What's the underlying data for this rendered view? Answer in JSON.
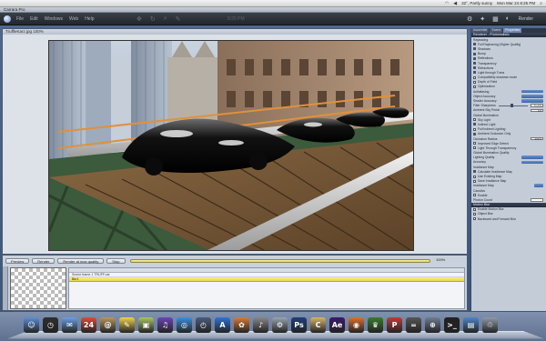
{
  "menubar": {
    "weather": "32°, Partly sunny",
    "clock": "Mon Mar 24  8:25 PM"
  },
  "app": {
    "title": "Carrara Pro",
    "menus": [
      "File",
      "Edit",
      "Windows",
      "Web",
      "Help"
    ],
    "toolbar_clock": "8:25 PM",
    "render_label": "Render"
  },
  "document": {
    "title": "TruffleKarz.jpg 100%"
  },
  "render_bar": {
    "buttons": [
      "Preview",
      "Render",
      "Render at max quality",
      "Stop"
    ],
    "progress": 1.0,
    "progress_label": "100%",
    "list_row_1": "Scene frame 1 TRUFF.car",
    "list_row_2": "Bkr1"
  },
  "panel": {
    "tabs": [
      "Assemble",
      "Scene",
      "Properties"
    ],
    "section_title": "Renderer - Photorealistic",
    "rows": [
      {
        "label": "Raytracing",
        "kind": "text"
      },
      {
        "label": "Full Raytracing (Higher Quality)",
        "kind": "check",
        "on": true
      },
      {
        "label": "Shadows",
        "kind": "check",
        "on": true
      },
      {
        "label": "Bump",
        "kind": "check",
        "on": true
      },
      {
        "label": "Reflections",
        "kind": "check",
        "on": true
      },
      {
        "label": "Transparency",
        "kind": "check",
        "on": true
      },
      {
        "label": "Refractions",
        "kind": "check",
        "on": true
      },
      {
        "label": "Light through Trans",
        "kind": "check",
        "on": true
      },
      {
        "label": "Compatibility shadows mode",
        "kind": "check",
        "on": false
      },
      {
        "label": "Depth of Field",
        "kind": "check",
        "on": false
      },
      {
        "label": "Optimization",
        "kind": "check",
        "on": false
      },
      {
        "label": "Antialiasing",
        "kind": "popup"
      },
      {
        "label": "Object Accuracy",
        "kind": "popup"
      },
      {
        "label": "Shader Accuracy",
        "kind": "popup"
      },
      {
        "label": "Filter Sharpness",
        "kind": "slider",
        "value": "71.0%"
      },
      {
        "label": "Ambient Sky Portal",
        "kind": "field",
        "value": "0.0"
      },
      {
        "label": "Global Illumination",
        "kind": "text"
      },
      {
        "label": "Sky Light",
        "kind": "check",
        "on": false
      },
      {
        "label": "Indirect Light",
        "kind": "check",
        "on": true
      },
      {
        "label": "Full Indirect Lighting",
        "kind": "check",
        "on": false
      },
      {
        "label": "Ambient Occlusion Only",
        "kind": "check",
        "on": true
      },
      {
        "label": "Occlusion Radius",
        "kind": "field",
        "value": "100.0"
      },
      {
        "label": "Improved Edge Detect",
        "kind": "check",
        "on": false
      },
      {
        "label": "Light Through Transparency",
        "kind": "check",
        "on": false
      },
      {
        "label": "Global Illumination Quality",
        "kind": "text"
      },
      {
        "label": "Lighting Quality",
        "kind": "popup"
      },
      {
        "label": "Accuracy",
        "kind": "popup"
      },
      {
        "label": "Irradiance Map",
        "kind": "text"
      },
      {
        "label": "Calculate Irradiance Map",
        "kind": "check",
        "on": true
      },
      {
        "label": "Use Existing Map",
        "kind": "check",
        "on": false
      },
      {
        "label": "Save Irradiance Map",
        "kind": "check",
        "on": false
      },
      {
        "label": "Irradiance Map",
        "kind": "button"
      },
      {
        "label": "Caustics",
        "kind": "text"
      },
      {
        "label": "Enable",
        "kind": "check",
        "on": false
      },
      {
        "label": "Photon Count",
        "kind": "field",
        "value": ""
      },
      {
        "label": "Motion Blur",
        "kind": "section"
      },
      {
        "label": "Enable Motion Blur",
        "kind": "check",
        "on": false
      },
      {
        "label": "Object Blur",
        "kind": "check",
        "on": false
      },
      {
        "label": "Backward and Forward Blur",
        "kind": "check",
        "on": false
      }
    ]
  },
  "colors": {
    "toolbar": "#2b3038",
    "panel": "#c4ccd8",
    "progress": "#efe26a",
    "accent": "#4f74bb"
  },
  "dock": [
    {
      "name": "finder-icon"
    },
    {
      "name": "dashboard-icon"
    },
    {
      "name": "mail-icon"
    },
    {
      "name": "ical-icon"
    },
    {
      "name": "address-book-icon"
    },
    {
      "name": "stickies-icon"
    },
    {
      "name": "preview-icon"
    },
    {
      "name": "itunes-icon"
    },
    {
      "name": "safari-icon"
    },
    {
      "name": "time-machine-icon"
    },
    {
      "name": "app-store-icon"
    },
    {
      "name": "photo-icon"
    },
    {
      "name": "garageband-icon"
    },
    {
      "name": "system-prefs-icon"
    },
    {
      "name": "photoshop-icon"
    },
    {
      "name": "carrara-icon"
    },
    {
      "name": "after-effects-icon"
    },
    {
      "name": "firefox-icon"
    },
    {
      "name": "game-icon"
    },
    {
      "name": "pcl-icon"
    },
    {
      "name": "calculator-icon"
    },
    {
      "name": "network-icon"
    },
    {
      "name": "terminal-icon"
    },
    {
      "name": "folder-icon"
    },
    {
      "name": "trash-icon"
    }
  ]
}
